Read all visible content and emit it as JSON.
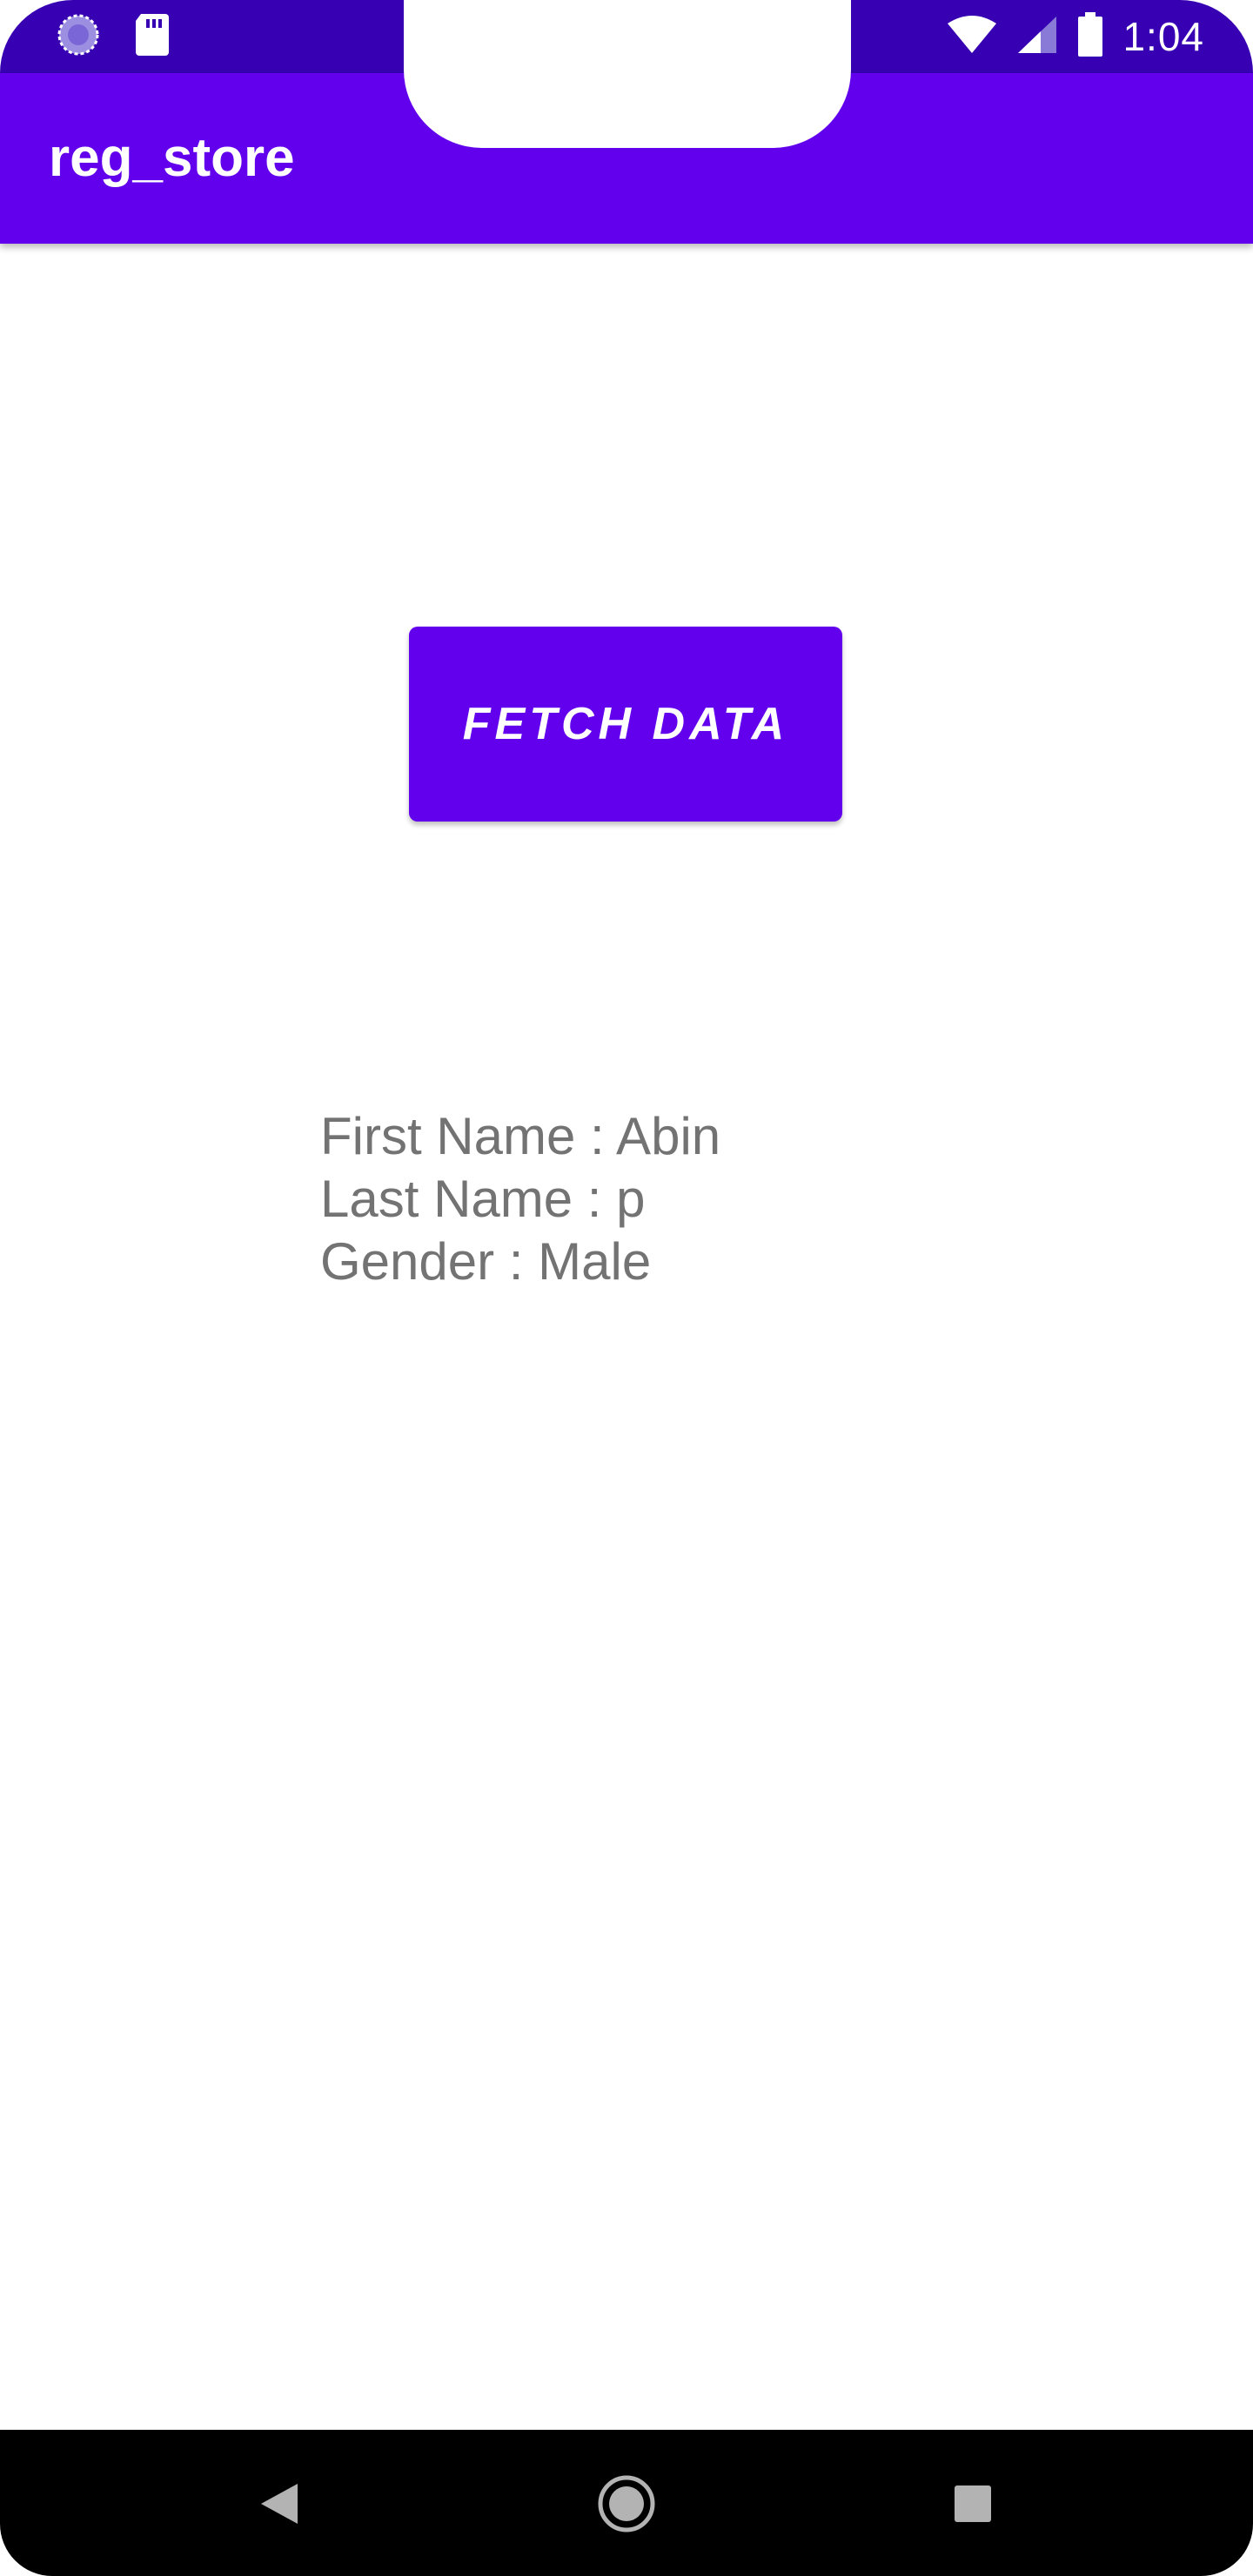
{
  "status_bar": {
    "time": "1:04",
    "left_icons": [
      "loading-icon",
      "sd-card-icon"
    ],
    "right_icons": [
      "wifi-icon",
      "cell-signal-icon",
      "battery-icon"
    ],
    "color": "#3700b3"
  },
  "app_bar": {
    "title": "reg_store",
    "color": "#6200ee"
  },
  "main": {
    "fetch_button_label": "FETCH DATA",
    "results": {
      "first_name": "First Name : Abin",
      "last_name": "Last Name : p",
      "gender": "Gender : Male"
    }
  },
  "nav_bar": {
    "buttons": [
      "back-icon",
      "home-icon",
      "recents-icon"
    ]
  }
}
